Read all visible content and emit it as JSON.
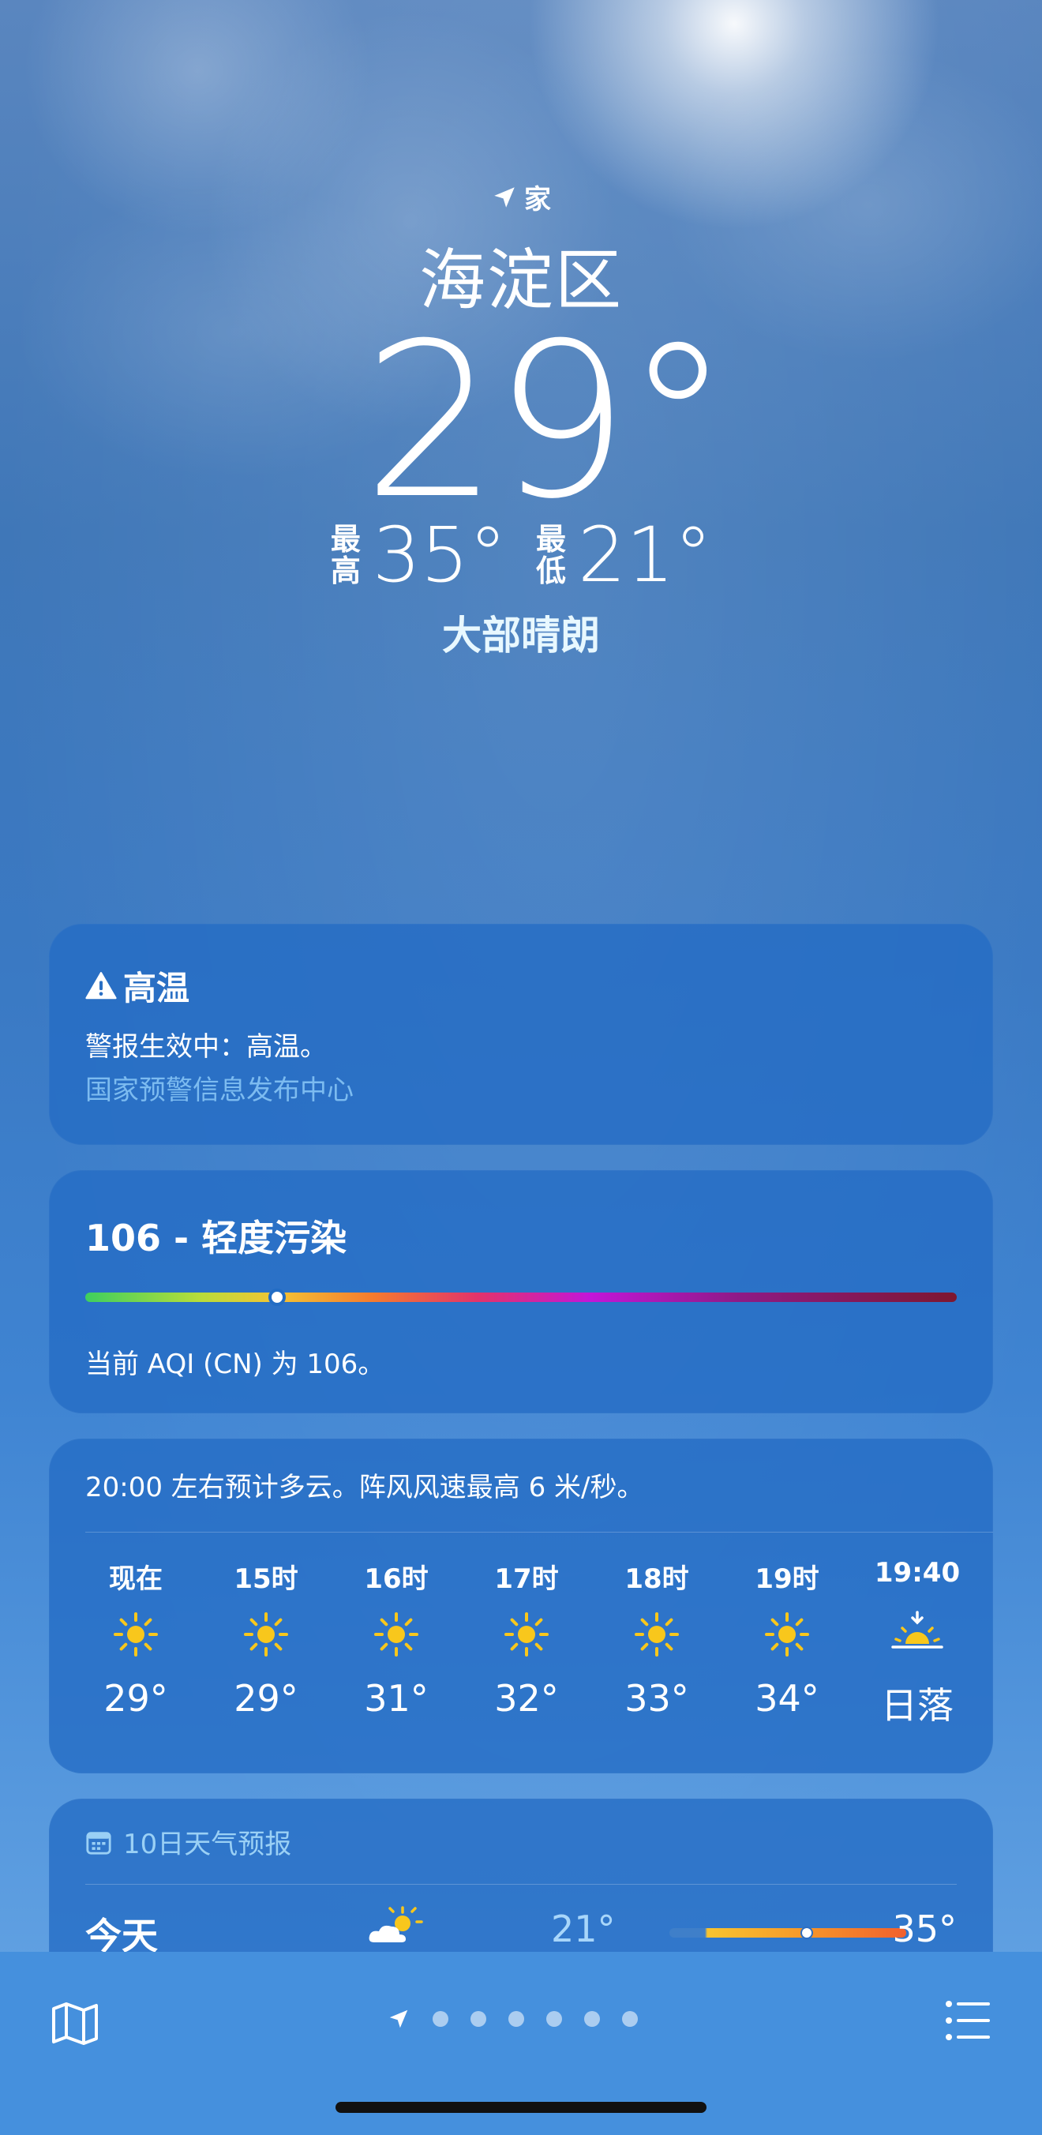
{
  "location": {
    "home_label": "家",
    "city": "海淀区",
    "temperature": "29°",
    "high_label": "最高",
    "high": "35°",
    "low_label": "最低",
    "low": "21°",
    "condition": "大部晴朗"
  },
  "alert": {
    "title": "高温",
    "body": "警报生效中：高温。",
    "source": "国家预警信息发布中心"
  },
  "aqi": {
    "title": "106 - 轻度污染",
    "value": 106,
    "indicator_fraction": 0.22,
    "description": "当前 AQI (CN) 为 106。"
  },
  "hourly": {
    "summary": "20:00 左右预计多云。阵风风速最高 6 米/秒。",
    "items": [
      {
        "time": "现在",
        "icon": "sun-icon",
        "temp": "29°"
      },
      {
        "time": "15时",
        "icon": "sun-icon",
        "temp": "29°"
      },
      {
        "time": "16时",
        "icon": "sun-icon",
        "temp": "31°"
      },
      {
        "time": "17时",
        "icon": "sun-icon",
        "temp": "32°"
      },
      {
        "time": "18时",
        "icon": "sun-icon",
        "temp": "33°"
      },
      {
        "time": "19时",
        "icon": "sun-icon",
        "temp": "34°"
      },
      {
        "time": "19:40",
        "icon": "sunset-icon",
        "temp": "日落"
      }
    ]
  },
  "forecast": {
    "title": "10日天气预报",
    "days": [
      {
        "day": "今天",
        "icon": "partly-cloudy-icon",
        "low": "21°",
        "high": "35°",
        "current_fraction": 0.58
      }
    ]
  },
  "pager": {
    "page_count": 6
  },
  "colors": {
    "card_bg": "#246cc4",
    "sun": "#f8c71c",
    "aqi_indicator": "#ffffff",
    "bottom_bar": "#4590dd"
  }
}
